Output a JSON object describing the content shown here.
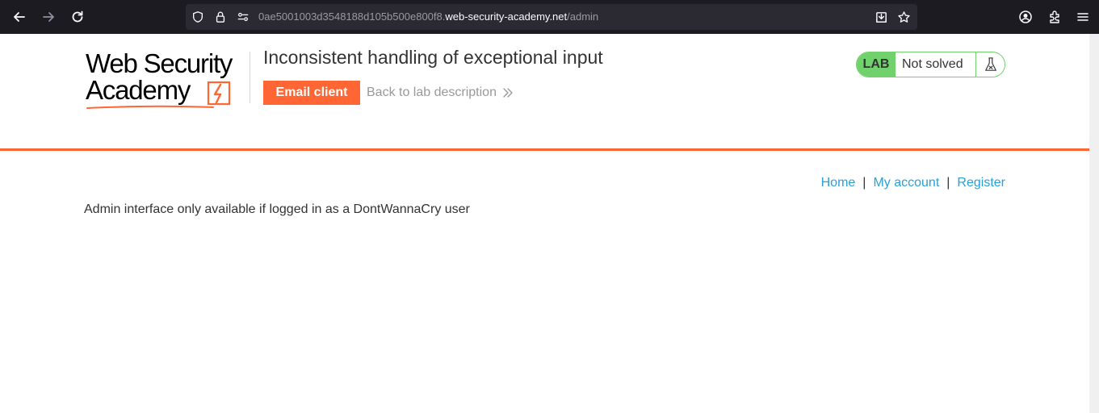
{
  "browser": {
    "url_prefix": "0ae5001003d3548188d105b500e800f8.",
    "url_host": "web-security-academy.net",
    "url_path": "/admin",
    "icons": [
      "back-arrow-icon",
      "forward-arrow-icon",
      "reload-icon",
      "shield-icon",
      "lock-icon",
      "permissions-icon",
      "download-page-icon",
      "bookmark-star-icon",
      "account-icon",
      "extensions-icon",
      "menu-icon"
    ]
  },
  "header": {
    "logo_line1": "Web Security",
    "logo_line2": "Academy",
    "lab_title": "Inconsistent handling of exceptional input",
    "email_button": "Email client",
    "back_link": "Back to lab description",
    "lab_tag": "LAB",
    "lab_status": "Not solved",
    "lab_icon": "flask-icon"
  },
  "nav": {
    "home": "Home",
    "separator": "|",
    "my_account": "My account",
    "register": "Register"
  },
  "main": {
    "message": "Admin interface only available if logged in as a DontWannaCry user"
  },
  "colors": {
    "brand_orange": "#ff6633",
    "lab_green": "#70d16d",
    "link_blue": "#29a0d8",
    "chrome_dark": "#1c1b22"
  }
}
